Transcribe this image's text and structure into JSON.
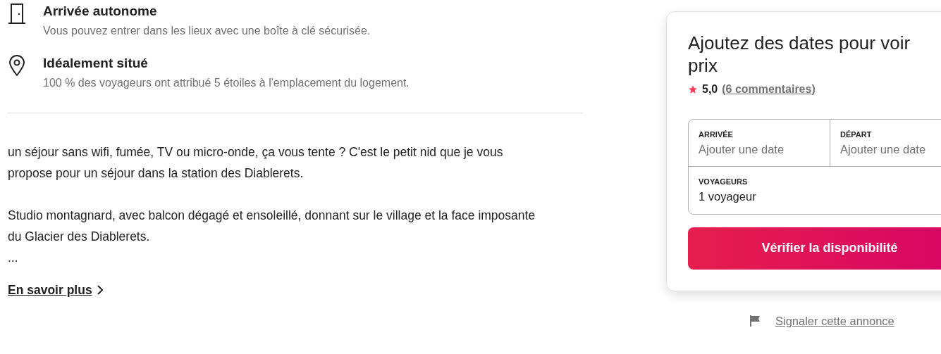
{
  "highlights": [
    {
      "kind": "door",
      "title": "Arrivée autonome",
      "text": "Vous pouvez entrer dans les lieux avec une boîte à clé sécurisée."
    },
    {
      "kind": "pin",
      "title": "Idéalement situé",
      "text": "100 % des voyageurs ont attribué 5 étoiles à l'emplacement du logement."
    }
  ],
  "description": [
    "un séjour sans wifi, fumée, TV ou micro-onde, ça vous tente ? C'est le petit nid que je vous propose pour un séjour dans la station des Diablerets.",
    "Studio montagnard, avec balcon dégagé et ensoleillé, donnant sur le village et la face imposante du Glacier des Diablerets.",
    "..."
  ],
  "more_link": "En savoir plus",
  "booking": {
    "title_lines": [
      "Ajoutez des dates pour voir",
      "prix"
    ],
    "rating": "5,0",
    "reviews": "(6 commentaires)",
    "checkin": {
      "label": "ARRIVÉE",
      "placeholder": "Ajouter une date"
    },
    "checkout": {
      "label": "DÉPART",
      "placeholder": "Ajouter une date"
    },
    "guests": {
      "label": "VOYAGEURS",
      "value": "1 voyageur"
    },
    "button": "Vérifier la disponibilité"
  },
  "report_link": "Signaler cette annonce"
}
